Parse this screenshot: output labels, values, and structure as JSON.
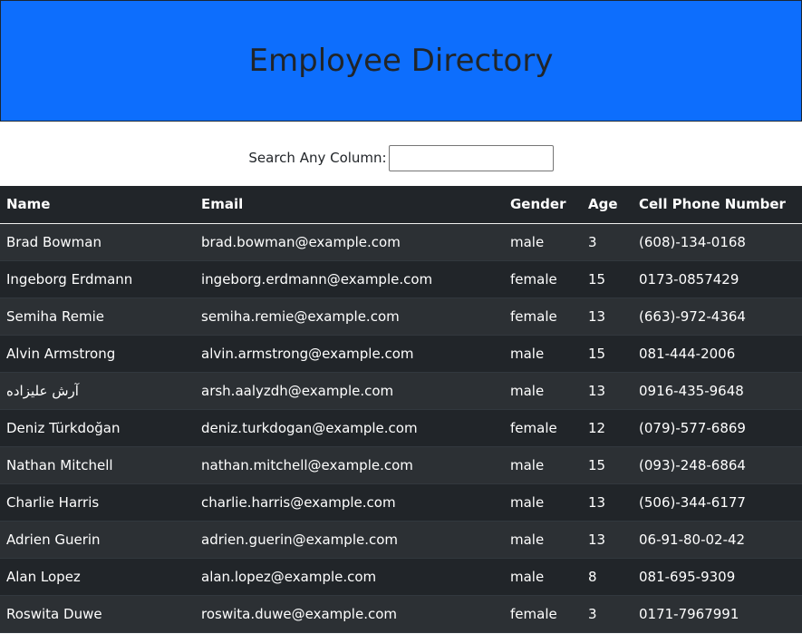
{
  "header": {
    "title": "Employee Directory",
    "background": "#0d6efd"
  },
  "search": {
    "label": "Search Any Column:",
    "value": ""
  },
  "table": {
    "columns": [
      "Name",
      "Email",
      "Gender",
      "Age",
      "Cell Phone Number"
    ],
    "rows": [
      [
        "Brad Bowman",
        "brad.bowman@example.com",
        "male",
        "3",
        "(608)-134-0168"
      ],
      [
        "Ingeborg Erdmann",
        "ingeborg.erdmann@example.com",
        "female",
        "15",
        "0173-0857429"
      ],
      [
        "Semiha Remie",
        "semiha.remie@example.com",
        "female",
        "13",
        "(663)-972-4364"
      ],
      [
        "Alvin Armstrong",
        "alvin.armstrong@example.com",
        "male",
        "15",
        "081-444-2006"
      ],
      [
        "آرش علیزاده",
        "arsh.aalyzdh@example.com",
        "male",
        "13",
        "0916-435-9648"
      ],
      [
        "Deniz Türkdoğan",
        "deniz.turkdogan@example.com",
        "female",
        "12",
        "(079)-577-6869"
      ],
      [
        "Nathan Mitchell",
        "nathan.mitchell@example.com",
        "male",
        "15",
        "(093)-248-6864"
      ],
      [
        "Charlie Harris",
        "charlie.harris@example.com",
        "male",
        "13",
        "(506)-344-6177"
      ],
      [
        "Adrien Guerin",
        "adrien.guerin@example.com",
        "male",
        "13",
        "06-91-80-02-42"
      ],
      [
        "Alan Lopez",
        "alan.lopez@example.com",
        "male",
        "8",
        "081-695-9309"
      ],
      [
        "Roswita Duwe",
        "roswita.duwe@example.com",
        "female",
        "3",
        "0171-7967991"
      ]
    ]
  }
}
